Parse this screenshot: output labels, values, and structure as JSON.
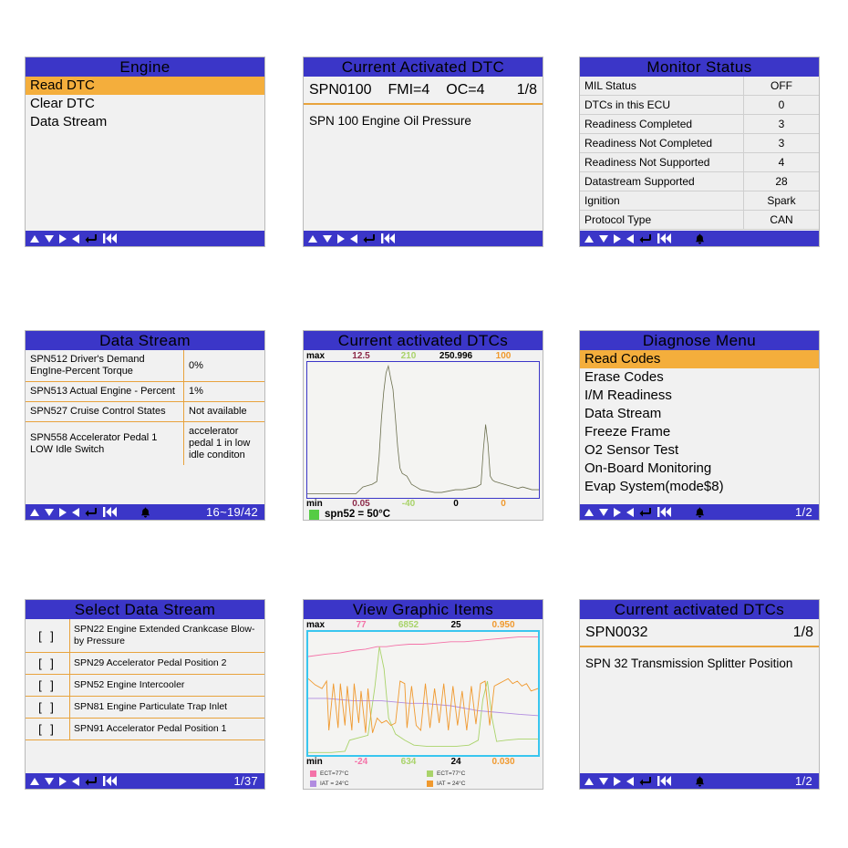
{
  "colors": {
    "title_bar": "#3b36c8",
    "highlight": "#f4ae3c",
    "rule_orange": "#e8a33d",
    "screen_bg": "#f1f1f1",
    "series_maroon": "#8d2b4a",
    "series_lightgreen": "#a9d36a",
    "series_black": "#000000",
    "series_orange": "#f0992e",
    "series_pink": "#f472a8",
    "series_purple": "#b18ce0",
    "plot_line_olive": "#6b6f4e",
    "legend_green": "#55cc44"
  },
  "toolbar": {
    "icons": [
      "triangle-up",
      "triangle-down",
      "triangle-right",
      "triangle-left",
      "enter-return",
      "skip-back"
    ],
    "bell": "bell-icon"
  },
  "panels": {
    "engine": {
      "title": "Engine",
      "items": [
        {
          "label": "Read DTC",
          "selected": true
        },
        {
          "label": "Clear DTC",
          "selected": false
        },
        {
          "label": "Data Stream",
          "selected": false
        }
      ],
      "page": ""
    },
    "current_activated_dtc": {
      "title": "Current Activated DTC",
      "code": "SPN0100",
      "fmi": "FMI=4",
      "oc": "OC=4",
      "index": "1/8",
      "description": "SPN 100 Engine Oil Pressure",
      "page": ""
    },
    "monitor_status": {
      "title": "Monitor Status",
      "rows": [
        {
          "key": "MIL Status",
          "value": "OFF"
        },
        {
          "key": "DTCs in this ECU",
          "value": "0"
        },
        {
          "key": "Readiness Completed",
          "value": "3"
        },
        {
          "key": "Readiness Not Completed",
          "value": "3"
        },
        {
          "key": "Readiness Not Supported",
          "value": "4"
        },
        {
          "key": "Datastream Supported",
          "value": "28"
        },
        {
          "key": "Ignition",
          "value": "Spark"
        },
        {
          "key": "Protocol Type",
          "value": "CAN"
        }
      ],
      "page": ""
    },
    "data_stream": {
      "title": "Data Stream",
      "rows": [
        {
          "name": "SPN512 Driver's Demand EngIne-Percent Torque",
          "value": "0%"
        },
        {
          "name": "SPN513 Actual Engine - Percent",
          "value": "1%"
        },
        {
          "name": "SPN527 Cruise Control States",
          "value": "Not available"
        },
        {
          "name": "SPN558 Accelerator Pedal 1 LOW Idle Switch",
          "value": "accelerator pedal 1 in low idle conditon"
        }
      ],
      "page": "16~19/42"
    },
    "current_activated_dtcs_graph": {
      "title": "Current activated DTCs",
      "max_label": "max",
      "min_label": "min",
      "max_values": [
        "12.5",
        "210",
        "250.996",
        "100"
      ],
      "min_values": [
        "0.05",
        "-40",
        "0",
        "0"
      ],
      "legend": "spn52 = 50°C",
      "page": ""
    },
    "diagnose_menu": {
      "title": "Diagnose Menu",
      "items": [
        {
          "label": "Read Codes",
          "selected": true
        },
        {
          "label": "Erase Codes",
          "selected": false
        },
        {
          "label": "I/M Readiness",
          "selected": false
        },
        {
          "label": "Data Stream",
          "selected": false
        },
        {
          "label": "Freeze Frame",
          "selected": false
        },
        {
          "label": "O2 Sensor Test",
          "selected": false
        },
        {
          "label": "On-Board Monitoring",
          "selected": false
        },
        {
          "label": "Evap System(mode$8)",
          "selected": false
        }
      ],
      "page": "1/2"
    },
    "select_data_stream": {
      "title": "Select Data Stream",
      "rows": [
        {
          "check": "[    ]",
          "name": "SPN22 Engine Extended Crankcase Blow-by Pressure"
        },
        {
          "check": "[    ]",
          "name": "SPN29 Accelerator Pedal Position 2"
        },
        {
          "check": "[    ]",
          "name": "SPN52 Engine Intercooler"
        },
        {
          "check": "[    ]",
          "name": "SPN81 Engine Particulate Trap Inlet"
        },
        {
          "check": "[    ]",
          "name": "SPN91 Accelerator Pedal Position 1"
        }
      ],
      "page": "1/37"
    },
    "view_graphic_items": {
      "title": "View Graphic Items",
      "max_label": "max",
      "min_label": "min",
      "max_values": [
        "77",
        "6852",
        "25",
        "0.950"
      ],
      "min_values": [
        "-24",
        "634",
        "24",
        "0.030"
      ],
      "legend": [
        {
          "label": "ECT=77°C",
          "color": "#f472a8"
        },
        {
          "label": "ECT=77°C",
          "color": "#a9d36a"
        },
        {
          "label": "IAT = 24°C",
          "color": "#b18ce0"
        },
        {
          "label": "IAT = 24°C",
          "color": "#f0992e"
        }
      ],
      "page": ""
    },
    "current_activated_dtcs_detail": {
      "title": "Current activated DTCs",
      "code": "SPN0032",
      "index": "1/8",
      "description": "SPN 32 Transmission Splitter Position",
      "page": "1/2"
    }
  },
  "chart_data": [
    {
      "type": "line",
      "id": "spn52-trace",
      "title": "Current activated DTCs",
      "legend_position": "bottom-left",
      "grid": false,
      "series": [
        {
          "name": "spn52",
          "color": "#6b6f4e",
          "x": [
            0,
            3,
            7,
            11,
            15,
            18,
            21,
            24,
            26,
            28,
            30,
            31,
            32,
            33,
            34,
            35,
            36,
            37,
            38,
            39,
            40,
            41,
            43,
            45,
            47,
            49,
            52,
            55,
            58,
            61,
            64,
            67,
            70,
            73,
            75,
            76,
            77,
            78,
            79,
            80,
            81,
            83,
            85,
            87,
            89,
            91,
            93,
            95,
            97,
            100
          ],
          "y": [
            3,
            3,
            3,
            3,
            3,
            3,
            3,
            8,
            9,
            10,
            12,
            30,
            58,
            78,
            92,
            97,
            88,
            80,
            60,
            38,
            22,
            18,
            16,
            10,
            8,
            6,
            5,
            4,
            4,
            5,
            6,
            6,
            7,
            8,
            10,
            35,
            54,
            40,
            16,
            13,
            12,
            11,
            10,
            9,
            8,
            7,
            8,
            7,
            6,
            6
          ]
        }
      ],
      "axis_labels": {
        "max_row": [
          "max",
          "12.5",
          "210",
          "250.996",
          "100"
        ],
        "min_row": [
          "min",
          "0.05",
          "-40",
          "0",
          "0"
        ]
      },
      "ylim": [
        0,
        100
      ],
      "xlim": [
        0,
        100
      ],
      "annotations": [
        "spn52 = 50°C"
      ]
    },
    {
      "type": "line",
      "id": "view-graphic-items",
      "title": "View Graphic Items",
      "legend_position": "bottom",
      "grid": false,
      "series": [
        {
          "name": "ECT-pink",
          "color": "#f472a8",
          "x": [
            0,
            8,
            14,
            20,
            25,
            30,
            34,
            38,
            44,
            50,
            56,
            62,
            68,
            74,
            80,
            86,
            92,
            100
          ],
          "y": [
            80,
            82,
            83,
            85,
            86,
            88,
            88,
            89,
            90,
            90,
            91,
            92,
            92,
            93,
            94,
            95,
            96,
            96
          ]
        },
        {
          "name": "ECT-green",
          "color": "#a9d36a",
          "x": [
            0,
            10,
            16,
            18,
            22,
            26,
            29,
            31,
            33,
            35,
            38,
            42,
            46,
            52,
            58,
            64,
            70,
            74,
            76,
            78,
            80,
            82,
            86,
            92,
            100
          ],
          "y": [
            2,
            2,
            3,
            12,
            14,
            16,
            55,
            88,
            70,
            30,
            17,
            12,
            8,
            7,
            7,
            7,
            8,
            12,
            45,
            60,
            30,
            11,
            12,
            13,
            13
          ]
        },
        {
          "name": "IAT-purple",
          "color": "#b18ce0",
          "x": [
            0,
            8,
            14,
            20,
            26,
            32,
            38,
            44,
            50,
            56,
            62,
            68,
            74,
            80,
            86,
            92,
            100
          ],
          "y": [
            46,
            46,
            45,
            44,
            44,
            44,
            43,
            42,
            42,
            41,
            40,
            38,
            36,
            35,
            34,
            33,
            32
          ]
        },
        {
          "name": "IAT-orange",
          "color": "#f0992e",
          "x": [
            0,
            3,
            6,
            8,
            9,
            11,
            13,
            14,
            16,
            17,
            19,
            20,
            22,
            23,
            25,
            26,
            28,
            30,
            32,
            34,
            36,
            38,
            40,
            42,
            43,
            45,
            47,
            49,
            51,
            53,
            55,
            57,
            59,
            61,
            63,
            65,
            67,
            69,
            71,
            73,
            75,
            77,
            79,
            81,
            83,
            85,
            87,
            89,
            91,
            93,
            95,
            97,
            100
          ],
          "y": [
            62,
            57,
            54,
            60,
            20,
            58,
            22,
            58,
            24,
            56,
            20,
            58,
            26,
            52,
            18,
            54,
            18,
            30,
            26,
            28,
            24,
            26,
            60,
            58,
            22,
            56,
            24,
            20,
            58,
            22,
            54,
            26,
            58,
            20,
            56,
            24,
            52,
            20,
            56,
            25,
            58,
            60,
            24,
            56,
            58,
            60,
            62,
            58,
            60,
            56,
            58,
            52,
            54
          ]
        }
      ],
      "axis_labels": {
        "max_row": [
          "max",
          "77",
          "6852",
          "25",
          "0.950"
        ],
        "min_row": [
          "min",
          "-24",
          "634",
          "24",
          "0.030"
        ]
      },
      "ylim": [
        0,
        100
      ],
      "xlim": [
        0,
        100
      ]
    }
  ]
}
